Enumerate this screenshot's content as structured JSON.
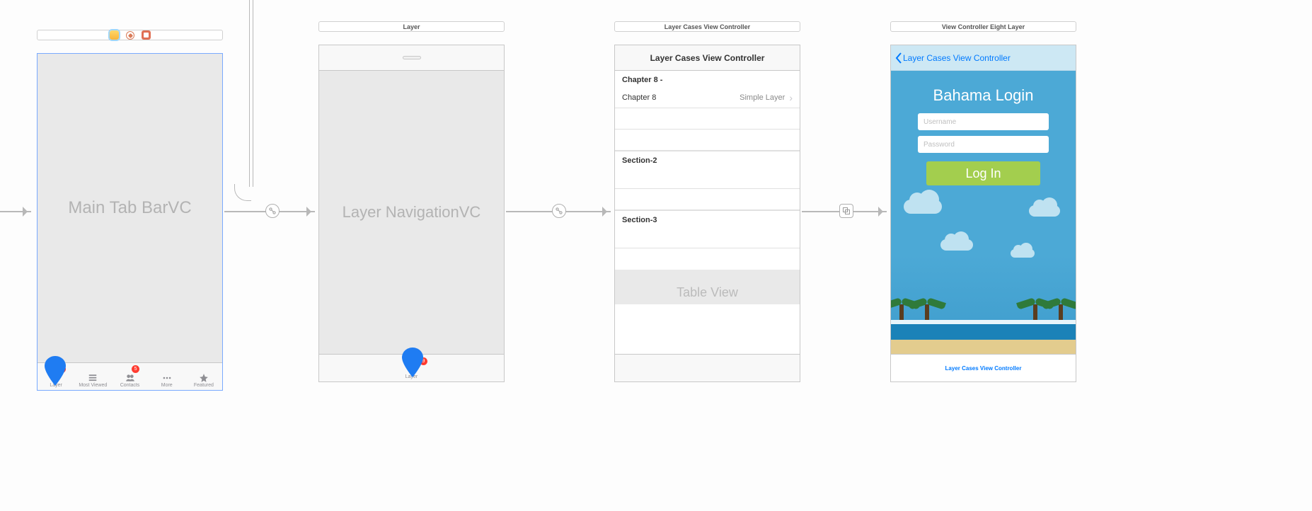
{
  "scene1": {
    "big_label": "Main Tab BarVC",
    "tabs": [
      {
        "label": "Layer",
        "badge": "9"
      },
      {
        "label": "Most Viewed",
        "badge": null
      },
      {
        "label": "Contacts",
        "badge": "5"
      },
      {
        "label": "More",
        "badge": null
      },
      {
        "label": "Featured",
        "badge": null
      }
    ]
  },
  "scene2": {
    "title": "Layer",
    "big_label": "Layer NavigationVC",
    "tab_label": "Layer",
    "tab_badge": "9"
  },
  "scene3": {
    "title": "Layer Cases View Controller",
    "nav_title": "Layer Cases View Controller",
    "section1_hdr": "Chapter 8 -",
    "row_title": "Chapter 8",
    "row_detail": "Simple Layer",
    "section2_hdr": "Section-2",
    "section3_hdr": "Section-3",
    "footer_label": "Table View"
  },
  "scene4": {
    "title": "View Controller Eight Layer",
    "back_label": "Layer Cases View Controller",
    "login_title": "Bahama Login",
    "username_ph": "Username",
    "password_ph": "Password",
    "login_btn": "Log In",
    "tab_label": "Layer Cases View Controller"
  }
}
